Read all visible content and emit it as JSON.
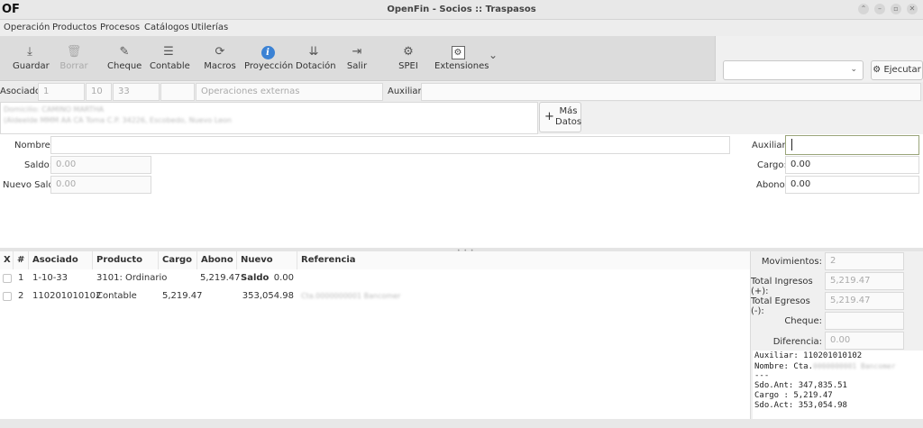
{
  "window": {
    "logo": "OF",
    "title": "OpenFin - Socios :: Traspasos",
    "controls": [
      "⌃",
      "–",
      "▫",
      "✕"
    ]
  },
  "menu": [
    "Operación",
    "Productos",
    "Procesos",
    "Catálogos",
    "Utilerías"
  ],
  "toolbar": {
    "buttons": [
      {
        "label": "Guardar",
        "icon": "download-icon",
        "glyph": "⤓",
        "enabled": true
      },
      {
        "label": "Borrar",
        "icon": "trash-icon",
        "glyph": "🗑",
        "enabled": false
      },
      {
        "label": "Cheque",
        "icon": "cheque-pen-icon",
        "glyph": "✎",
        "enabled": true
      },
      {
        "label": "Contable",
        "icon": "list-icon",
        "glyph": "☰",
        "enabled": true
      },
      {
        "label": "Macros",
        "icon": "refresh-icon",
        "glyph": "⟳",
        "enabled": true
      },
      {
        "label": "Proyección",
        "icon": "info-icon",
        "glyph": "i",
        "enabled": true
      },
      {
        "label": "Dotación",
        "icon": "sort-down-icon",
        "glyph": "⇊",
        "enabled": true
      },
      {
        "label": "Salir",
        "icon": "exit-icon",
        "glyph": "⇥",
        "enabled": true
      },
      {
        "label": "SPEI",
        "icon": "gear-icon",
        "glyph": "⚙",
        "enabled": true
      },
      {
        "label": "Extensiones",
        "icon": "extension-gear-icon",
        "glyph": "⚙",
        "enabled": true
      }
    ],
    "more_glyph": "⌄",
    "combo_value": "",
    "combo_chevron": "⌄",
    "execute_label": "Ejecutar",
    "execute_glyph": "⚙"
  },
  "asociado": {
    "label": "Asociado:",
    "field1": "1",
    "field2": "10",
    "field3": "33",
    "field4": "",
    "operaciones_placeholder": "Operaciones externas",
    "auxiliar_label": "Auxiliar:",
    "auxiliar_value": "",
    "address_line1": "Domicilio: CAMINO MARTHA",
    "address_line2": "(Aldeelde MMM AA          CA Toma C.P. 34226, Escobedo, Nuevo Leon",
    "mas_datos_plus": "+",
    "mas_datos_label_1": "Más",
    "mas_datos_label_2": "Datos"
  },
  "form": {
    "nombre_label": "Nombre:",
    "nombre_value": "",
    "saldo_label": "Saldo:",
    "saldo_value": "0.00",
    "nuevo_saldo_label": "Nuevo Saldo",
    "nuevo_saldo_value": "0.00",
    "auxiliar_label": "Auxiliar:",
    "auxiliar_value": "",
    "cargo_label": "Cargo:",
    "cargo_value": "0.00",
    "abono_label": "Abono:",
    "abono_value": "0.00"
  },
  "grid": {
    "grip": "• • •",
    "columns": [
      "X",
      "#",
      "Asociado",
      "Producto",
      "Cargo",
      "Abono",
      "Nuevo Saldo",
      "Referencia"
    ],
    "rows": [
      {
        "num": "1",
        "asociado": "1-10-33",
        "producto": "3101: Ordinario",
        "cargo": "",
        "abono": "5,219.47",
        "nuevo_saldo": "0.00",
        "referencia": ""
      },
      {
        "num": "2",
        "asociado": "110201010102",
        "producto": "Contable",
        "cargo": "5,219.47",
        "abono": "",
        "nuevo_saldo": "353,054.98",
        "referencia": "Cta.0000000001 Bancomer"
      }
    ]
  },
  "summary": {
    "movimientos_label": "Movimientos:",
    "movimientos_value": "2",
    "ingresos_label": "Total Ingresos (+):",
    "ingresos_value": "5,219.47",
    "egresos_label": "Total Egresos (-):",
    "egresos_value": "5,219.47",
    "cheque_label": "Cheque:",
    "cheque_value": "",
    "diferencia_label": "Diferencia:",
    "diferencia_value": "0.00"
  },
  "info": {
    "line1": "Auxiliar: 110201010102",
    "line2_prefix": "Nombre: Cta.",
    "line2_blur": "0000000001 Bancomer",
    "line3": "---",
    "line4": "Sdo.Ant: 347,835.51",
    "line5": "Cargo  : 5,219.47",
    "line6": "Sdo.Act: 353,054.98"
  }
}
